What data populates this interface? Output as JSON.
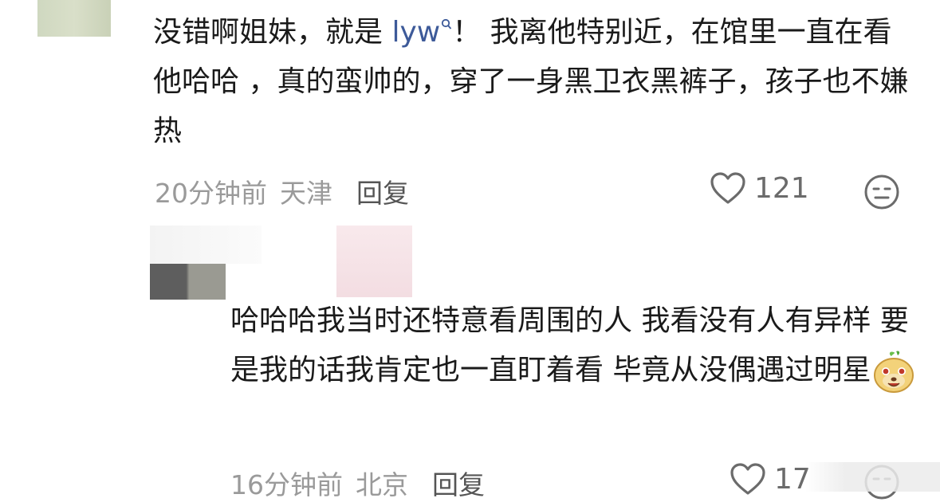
{
  "comment1": {
    "text_before": "没错啊姐妹，就是 ",
    "mention": "lyw",
    "mention_icon": "search-icon",
    "text_after": "！ 我离他特别近，在馆里一直在看他哈哈 ，真的蛮帅的，穿了一身黑卫衣黑裤子，孩子也不嫌热",
    "time": "20分钟前",
    "location": "天津",
    "reply_label": "回复",
    "likes": "121"
  },
  "comment2": {
    "text": "哈哈哈我当时还特意看周围的人 我看没有人有异样 要是我的话我肯定也一直盯着看 毕竟从没偶遇过明星",
    "sticker": "smiling-emoji-sticker",
    "time": "16分钟前",
    "location": "北京",
    "reply_label": "回复",
    "likes": "17"
  },
  "colors": {
    "text": "#1a1a1a",
    "meta": "#9a9a9a",
    "mention": "#3d5a99"
  }
}
